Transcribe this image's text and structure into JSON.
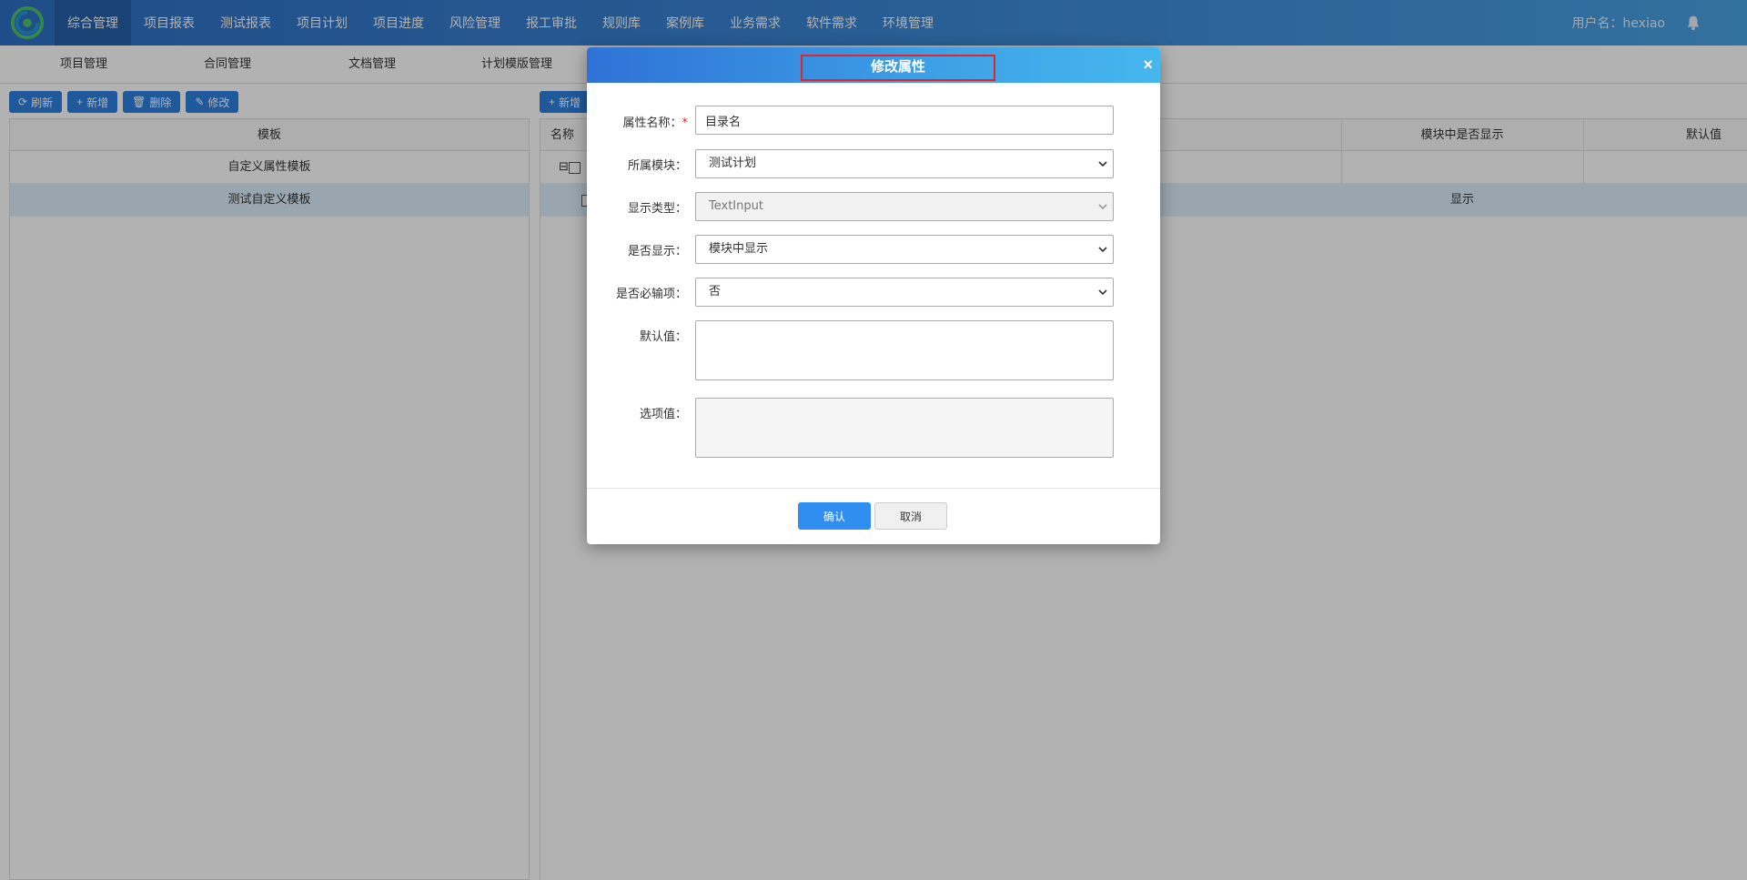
{
  "nav": {
    "items": [
      "综合管理",
      "项目报表",
      "测试报表",
      "项目计划",
      "项目进度",
      "风险管理",
      "报工审批",
      "规则库",
      "案例库",
      "业务需求",
      "软件需求",
      "环境管理"
    ],
    "user": "用户名：hexiao"
  },
  "subnav": {
    "items": [
      "项目管理",
      "合同管理",
      "文档管理",
      "计划模版管理"
    ]
  },
  "toolbar": {
    "refresh": "刷新",
    "add": "新增",
    "delete": "删除",
    "edit": "修改"
  },
  "left_table": {
    "header": "模板",
    "rows": [
      "自定义属性模板",
      "测试自定义模板"
    ]
  },
  "right_table": {
    "add_label": "新增",
    "col_name": "名称",
    "col_show": "模块中是否显示",
    "col_default": "默认值",
    "row2_show": "显示"
  },
  "modal": {
    "title": "修改属性",
    "close": "×",
    "fields": {
      "name_label": "属性名称：",
      "name_required": "*",
      "name_value": "目录名",
      "module_label": "所属模块：",
      "module_value": "测试计划",
      "type_label": "显示类型：",
      "type_value": "TextInput",
      "show_label": "是否显示：",
      "show_value": "模块中显示",
      "required_label": "是否必输项：",
      "required_value": "否",
      "default_label": "默认值：",
      "options_label": "选项值："
    },
    "ok": "确认",
    "cancel": "取消"
  },
  "colors": {
    "nav_active": "#255fa8",
    "primary": "#2f8ef0",
    "title_highlight": "#e0262a"
  }
}
